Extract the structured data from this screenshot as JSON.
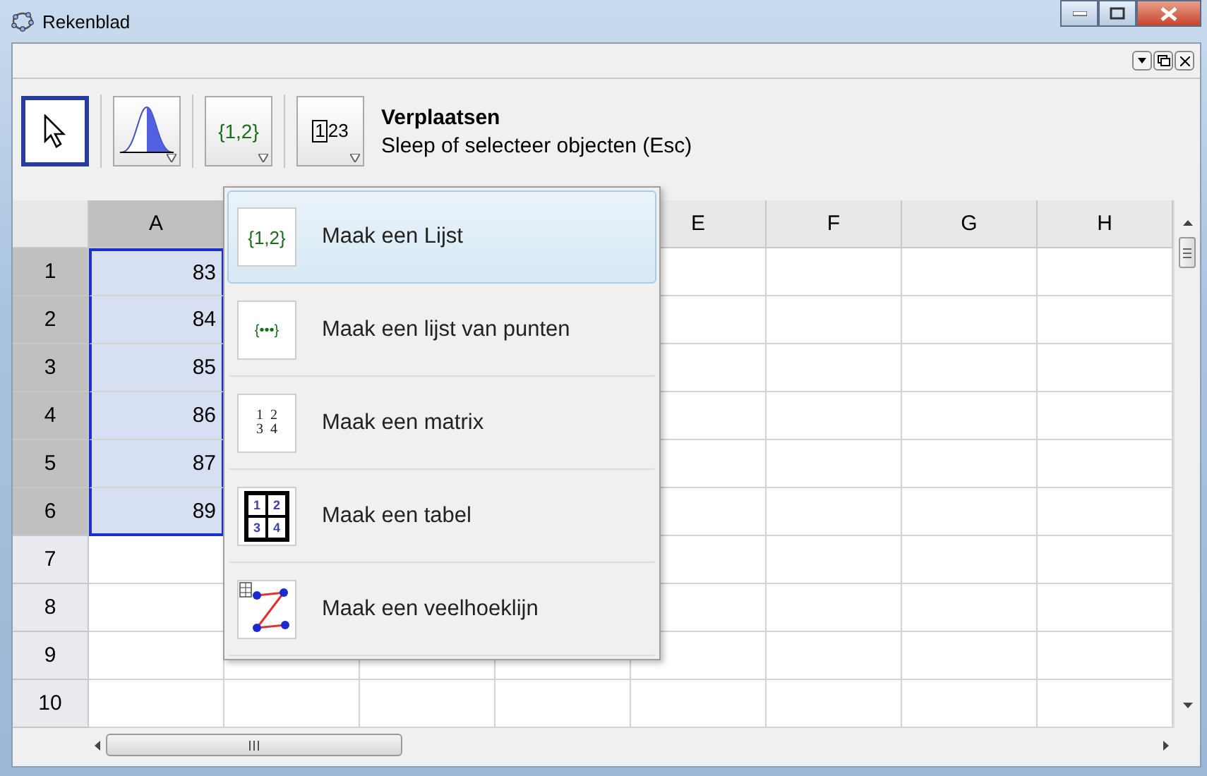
{
  "window": {
    "title": "Rekenblad"
  },
  "toolbar": {
    "tools": [
      {
        "kind": "move",
        "selected": true
      },
      {
        "kind": "distribution",
        "selected": false
      },
      {
        "kind": "list",
        "text": "{1,2}",
        "selected": false
      },
      {
        "kind": "table",
        "text": "123",
        "selected": false
      }
    ],
    "tool_name": "Verplaatsen",
    "tool_help": "Sleep of selecteer objecten (Esc)"
  },
  "spreadsheet": {
    "columns": [
      {
        "label": "A",
        "selected": true
      },
      {},
      {},
      {},
      {
        "label": "E",
        "selected": false
      },
      {
        "label": "F",
        "selected": false
      },
      {
        "label": "G",
        "selected": false
      },
      {
        "label": "H",
        "selected": false
      }
    ],
    "rows": [
      {
        "label": "1",
        "selected": true,
        "value": "83"
      },
      {
        "label": "2",
        "selected": true,
        "value": "84"
      },
      {
        "label": "3",
        "selected": true,
        "value": "85"
      },
      {
        "label": "4",
        "selected": true,
        "value": "86"
      },
      {
        "label": "5",
        "selected": true,
        "value": "87"
      },
      {
        "label": "6",
        "selected": true,
        "value": "89"
      },
      {
        "label": "7",
        "selected": false
      },
      {
        "label": "8",
        "selected": false
      },
      {
        "label": "9",
        "selected": false
      },
      {
        "label": "10",
        "selected": false
      }
    ]
  },
  "menu": {
    "items": [
      {
        "kind": "list",
        "icon_text": "{1,2}",
        "label": "Maak een Lijst",
        "selected": true
      },
      {
        "kind": "points",
        "icon_text": "{•••}",
        "label": "Maak een lijst van punten",
        "selected": false
      },
      {
        "kind": "matrix",
        "icon_cells": [
          "1",
          "2",
          "3",
          "4"
        ],
        "label": "Maak een matrix",
        "selected": false
      },
      {
        "kind": "table",
        "icon_cells": [
          "1",
          "2",
          "3",
          "4"
        ],
        "label": "Maak een tabel",
        "selected": false
      },
      {
        "kind": "polyline",
        "label": "Maak een veelhoeklijn",
        "selected": false
      }
    ]
  }
}
